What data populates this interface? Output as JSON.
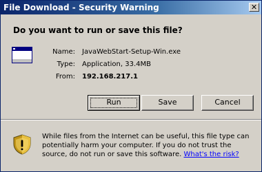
{
  "window": {
    "title": "File Download - Security Warning",
    "close_glyph": "✕"
  },
  "dialog": {
    "heading": "Do you want to run or save this file?",
    "file_icon": "application-window-icon",
    "fields": {
      "name_label": "Name:",
      "name_value": "JavaWebStart-Setup-Win.exe",
      "type_label": "Type:",
      "type_value": "Application, 33.4MB",
      "from_label": "From:",
      "from_value": "192.168.217.1"
    }
  },
  "buttons": {
    "run": "Run",
    "save": "Save",
    "cancel": "Cancel"
  },
  "warning": {
    "icon": "security-shield-icon",
    "text": "While files from the Internet can be useful, this file type can potentially harm your computer. If you do not trust the source, do not run or save this software.",
    "link": "What's the risk?"
  },
  "colors": {
    "title_bar_start": "#0a246a",
    "title_bar_end": "#a6caf0",
    "dialog_background": "#d4d0c8",
    "link": "#0000ff"
  }
}
